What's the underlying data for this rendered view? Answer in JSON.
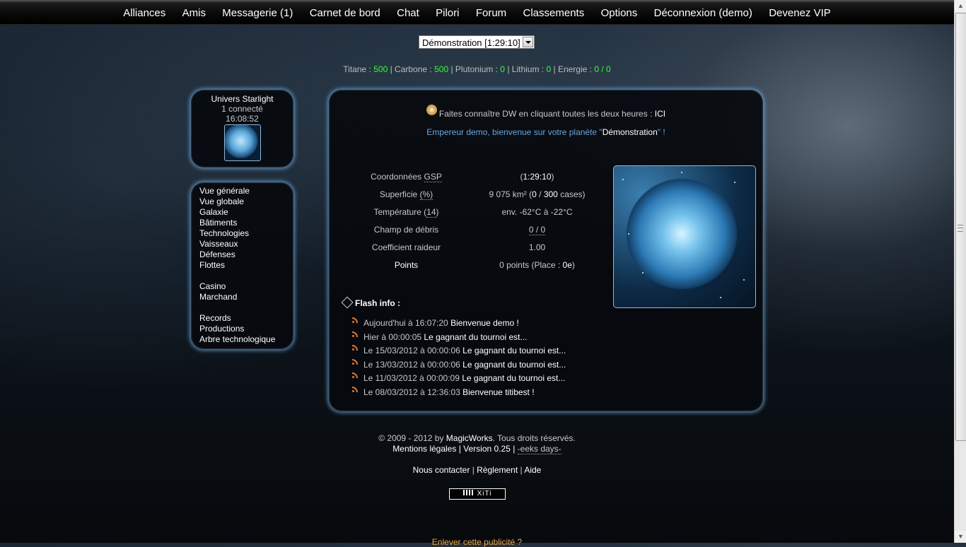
{
  "nav": [
    "Alliances",
    "Amis",
    "Messagerie (1)",
    "Carnet de bord",
    "Chat",
    "Pilori",
    "Forum",
    "Classements",
    "Options",
    "Déconnexion (demo)",
    "Devenez VIP"
  ],
  "planet_select": {
    "value": "Démonstration [1:29:10]"
  },
  "resources": {
    "titane_label": "Titane : ",
    "titane": "500",
    "carbone_label": "Carbone : ",
    "carbone": "500",
    "plutonium_label": "Plutonium : ",
    "plutonium": "0",
    "lithium_label": "Lithium : ",
    "lithium": "0",
    "energie_label": "Energie : ",
    "energie": "0 / 0",
    "sep": " | "
  },
  "univers": {
    "name": "Univers Starlight",
    "connected": "1 connecté",
    "time": "16:08:52"
  },
  "menu": {
    "group1": [
      "Vue générale",
      "Vue globale",
      "Galaxie",
      "Bâtiments",
      "Technologies",
      "Vaisseaux",
      "Défenses",
      "Flottes"
    ],
    "group2": [
      "Casino",
      "Marchand"
    ],
    "group3": [
      "Records",
      "Productions",
      "Arbre technologique"
    ]
  },
  "promo": {
    "text": "Faites connaître DW en cliquant toutes les deux heures : ",
    "link": "ICI"
  },
  "welcome": {
    "prefix": "Empereur demo, bienvenue sur votre planète \"",
    "planet": "Démonstration",
    "suffix": "\" !"
  },
  "info": {
    "coord_label": "Coordonnées ",
    "coord_abbr": "GSP",
    "coord_open": "(",
    "coord_value": "1:29:10",
    "coord_close": ")",
    "superficie_label": "Superficie ",
    "superficie_abbr": "(%)",
    "superficie_value": "9 075 km² (",
    "superficie_used": "0",
    "superficie_sep": " / ",
    "superficie_total": "300",
    "superficie_tail": " cases)",
    "temp_label": "Température ",
    "temp_open": "(",
    "temp_abbr": "14",
    "temp_close": ")",
    "temp_value": "env. -62°C à -22°C",
    "debris_label": "Champ de débris",
    "debris_value": "0 / 0",
    "raideur_label": "Coefficient raideur",
    "raideur_value": "1.00",
    "points_label": "Points",
    "points_value": "0 points (Place : ",
    "points_place": "0e",
    "points_tail": ")"
  },
  "flash": {
    "title": "Flash info :",
    "items": [
      {
        "date": "Aujourd'hui à 16:07:20 ",
        "msg": "Bienvenue demo !"
      },
      {
        "date": "Hier à 00:00:05 ",
        "msg": "Le gagnant du tournoi est..."
      },
      {
        "date": "Le 15/03/2012 à 00:00:06 ",
        "msg": "Le gagnant du tournoi est..."
      },
      {
        "date": "Le 13/03/2012 à 00:00:06 ",
        "msg": "Le gagnant du tournoi est..."
      },
      {
        "date": "Le 11/03/2012 à 00:00:09 ",
        "msg": "Le gagnant du tournoi est..."
      },
      {
        "date": "Le 08/03/2012 à 12:36:03 ",
        "msg": "Bienvenue titibest !"
      }
    ]
  },
  "footer": {
    "copyright_prefix": "© 2009 - 2012 by ",
    "company": "MagicWorks",
    "copyright_suffix": ". Tous droits réservés.",
    "legal": "Mentions légales",
    "version": " | Version 0.25 | ",
    "geeks": "-eeks days-",
    "contact": "Nous contacter",
    "reglement": "Règlement",
    "aide": "Aide",
    "sep": " | ",
    "xiti": "XiTi",
    "ad": "Enlever cette publicité ?"
  },
  "colors": {
    "resource_value": "#33ff33",
    "welcome": "#6aa5df",
    "panel_glow": "#6eaadc",
    "ad_link": "#e8a53a"
  }
}
